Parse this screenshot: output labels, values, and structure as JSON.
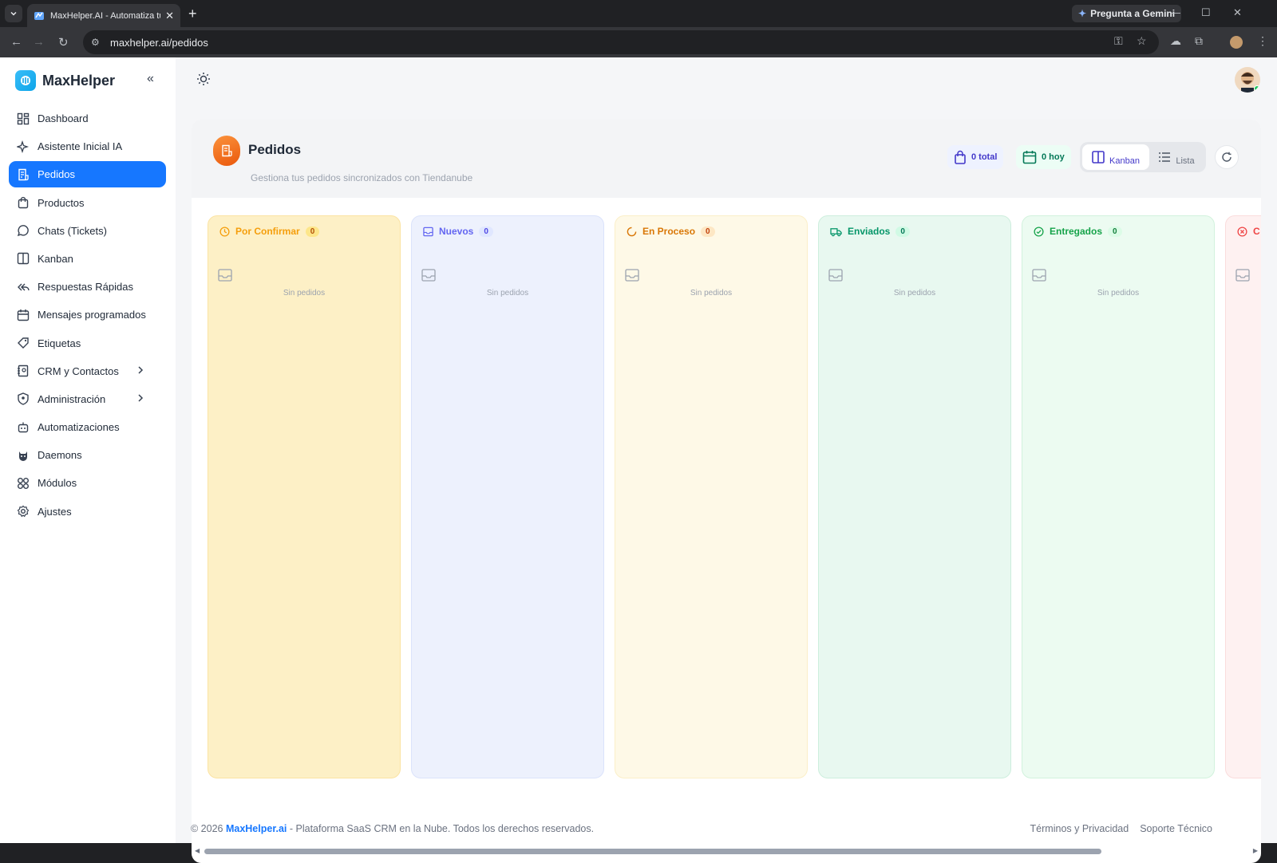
{
  "browser": {
    "tab_title": "MaxHelper.AI - Automatiza tu ...",
    "gemini_label": "Pregunta a Gemini",
    "url": "maxhelper.ai/pedidos"
  },
  "sidebar": {
    "brand": "MaxHelper",
    "items": [
      {
        "label": "Dashboard",
        "icon": "dashboard-icon"
      },
      {
        "label": "Asistente Inicial IA",
        "icon": "sparkle-icon"
      },
      {
        "label": "Pedidos",
        "icon": "receipt-icon",
        "active": true
      },
      {
        "label": "Productos",
        "icon": "shopping-bag-icon"
      },
      {
        "label": "Chats (Tickets)",
        "icon": "whatsapp-icon"
      },
      {
        "label": "Kanban",
        "icon": "kanban-icon"
      },
      {
        "label": "Respuestas Rápidas",
        "icon": "reply-all-icon"
      },
      {
        "label": "Mensajes programados",
        "icon": "calendar-icon"
      },
      {
        "label": "Etiquetas",
        "icon": "tag-icon"
      },
      {
        "label": "CRM y Contactos",
        "icon": "contacts-icon",
        "expandable": true
      },
      {
        "label": "Administración",
        "icon": "shield-user-icon",
        "expandable": true
      },
      {
        "label": "Automatizaciones",
        "icon": "robot-icon"
      },
      {
        "label": "Daemons",
        "icon": "daemon-icon"
      },
      {
        "label": "Módulos",
        "icon": "modules-icon"
      },
      {
        "label": "Ajustes",
        "icon": "gear-icon"
      }
    ]
  },
  "header": {
    "title": "Pedidos",
    "subtitle": "Gestiona tus pedidos sincronizados con Tiendanube",
    "total_label": "0 total",
    "today_label": "0 hoy",
    "view_kanban": "Kanban",
    "view_list": "Lista"
  },
  "columns": [
    {
      "title": "Por Confirmar",
      "count": "0",
      "empty": "Sin pedidos",
      "color": "#f59e0b"
    },
    {
      "title": "Nuevos",
      "count": "0",
      "empty": "Sin pedidos",
      "color": "#6366f1"
    },
    {
      "title": "En Proceso",
      "count": "0",
      "empty": "Sin pedidos",
      "color": "#d97706"
    },
    {
      "title": "Enviados",
      "count": "0",
      "empty": "Sin pedidos",
      "color": "#059669"
    },
    {
      "title": "Entregados",
      "count": "0",
      "empty": "Sin pedidos",
      "color": "#16a34a"
    },
    {
      "title": "C",
      "count": "",
      "empty": "",
      "color": "#ef4444"
    }
  ],
  "footer": {
    "copyright": "© 2026 ",
    "brand": "MaxHelper.ai",
    "rest": " - Plataforma SaaS CRM en la Nube. Todos los derechos reservados.",
    "terms": "Términos y Privacidad",
    "support": "Soporte Técnico"
  }
}
